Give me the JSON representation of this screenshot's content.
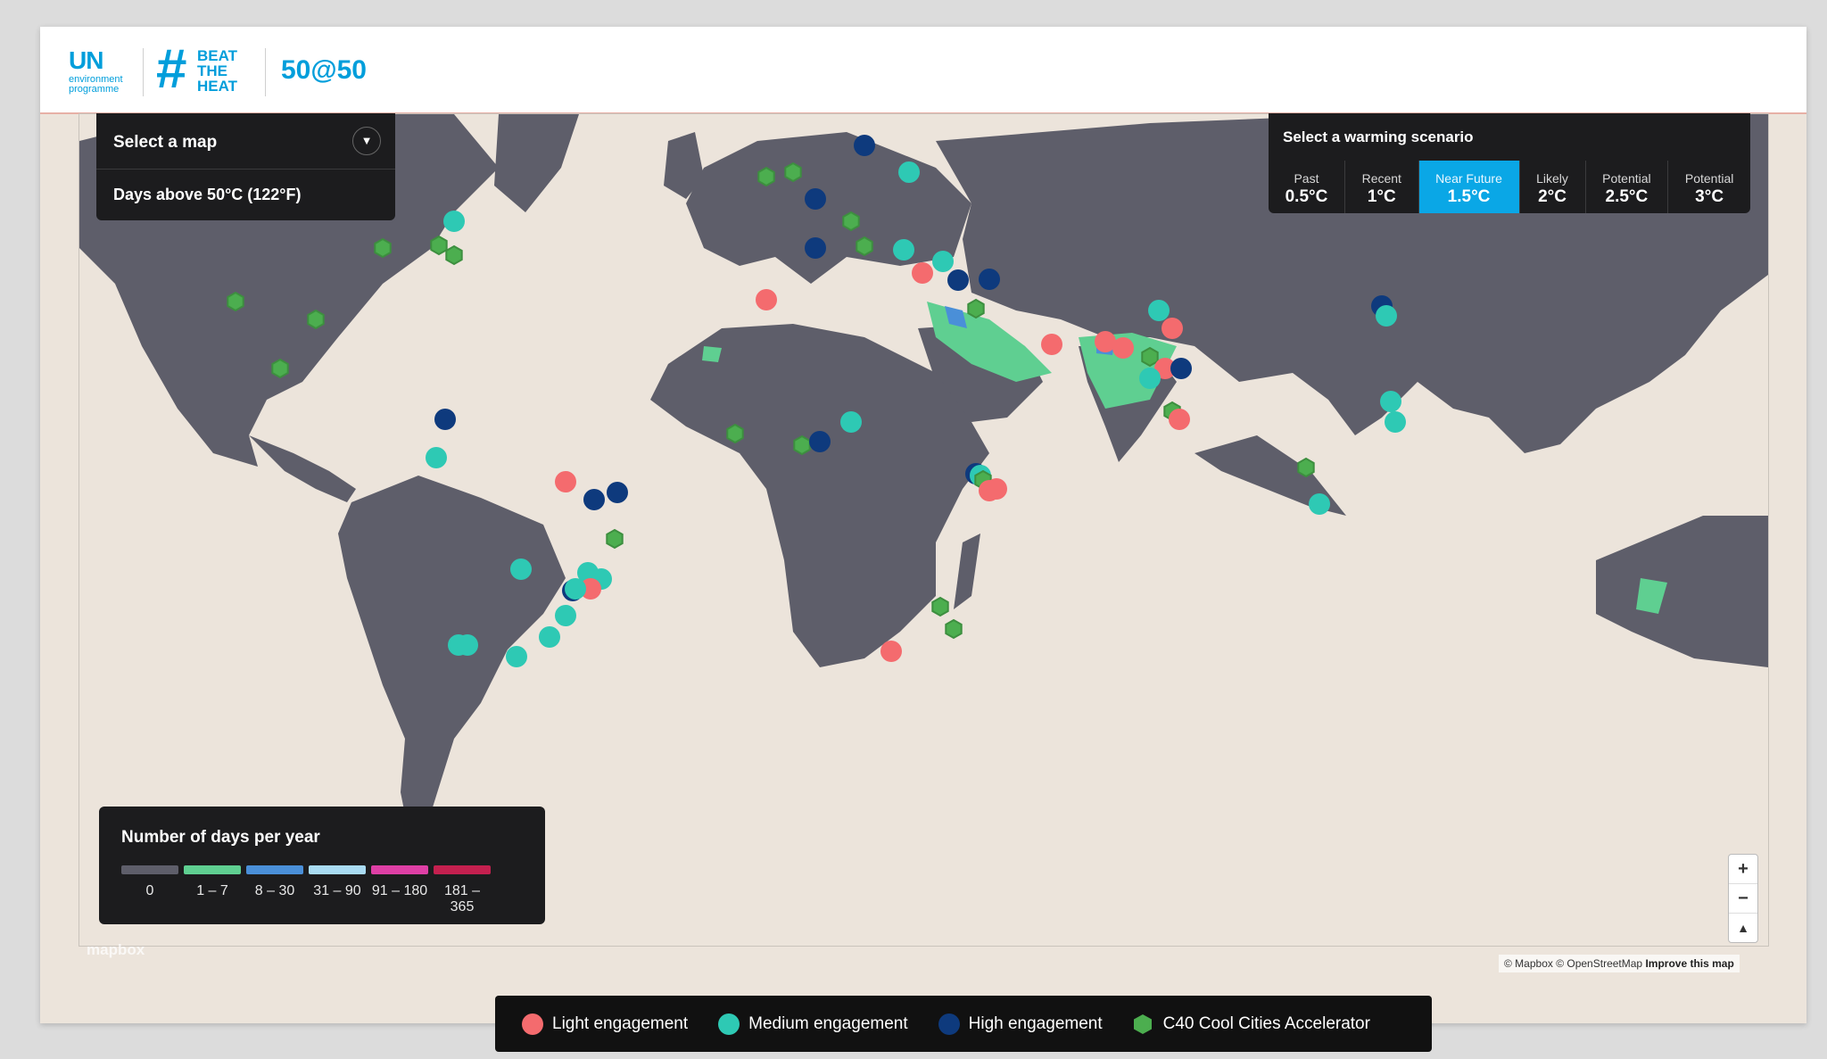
{
  "header": {
    "un_logo": {
      "main": "UN",
      "line1": "environment",
      "line2": "programme"
    },
    "btt_logo": {
      "hash": "#",
      "line1": "BEAT",
      "line2": "THE",
      "line3": "HEAT"
    },
    "campaign_label": "50@50"
  },
  "map_select": {
    "title": "Select a map",
    "current": "Days above 50°C (122°F)"
  },
  "scenario": {
    "title": "Select a warming scenario",
    "options": [
      {
        "label": "Past",
        "value": "0.5°C",
        "active": false
      },
      {
        "label": "Recent",
        "value": "1°C",
        "active": false
      },
      {
        "label": "Near Future",
        "value": "1.5°C",
        "active": true
      },
      {
        "label": "Likely",
        "value": "2°C",
        "active": false
      },
      {
        "label": "Potential",
        "value": "2.5°C",
        "active": false
      },
      {
        "label": "Potential",
        "value": "3°C",
        "active": false
      }
    ]
  },
  "days_legend": {
    "title": "Number of days per year",
    "items": [
      {
        "label": "0",
        "color": "#5e5e6a"
      },
      {
        "label": "1 – 7",
        "color": "#5fcf91"
      },
      {
        "label": "8 – 30",
        "color": "#4a8fd8"
      },
      {
        "label": "31 – 90",
        "color": "#a9dbf2"
      },
      {
        "label": "91 – 180",
        "color": "#de3fa5"
      },
      {
        "label": "181 – 365",
        "color": "#c4204f"
      }
    ]
  },
  "map": {
    "land_color": "#5e5e6a",
    "ocean_color": "#ece4db",
    "attribution": "© Mapbox © OpenStreetMap",
    "improve_link": "Improve this map",
    "mapbox_logo": "mapbox",
    "zoom_in": "+",
    "zoom_out": "−",
    "compass": "▲"
  },
  "engagement_legend": [
    {
      "label": "Light engagement",
      "color": "#f46b6e",
      "shape": "circle"
    },
    {
      "label": "Medium engagement",
      "color": "#2ec9b4",
      "shape": "circle"
    },
    {
      "label": "High engagement",
      "color": "#0e3a7d",
      "shape": "circle"
    },
    {
      "label": "C40 Cool Cities Accelerator",
      "color": "#4cae4f",
      "shape": "hexagon"
    }
  ],
  "colors": {
    "light": "#f46b6e",
    "medium": "#2ec9b4",
    "high": "#0e3a7d",
    "c40": "#4cae4f",
    "accent": "#009edb"
  }
}
